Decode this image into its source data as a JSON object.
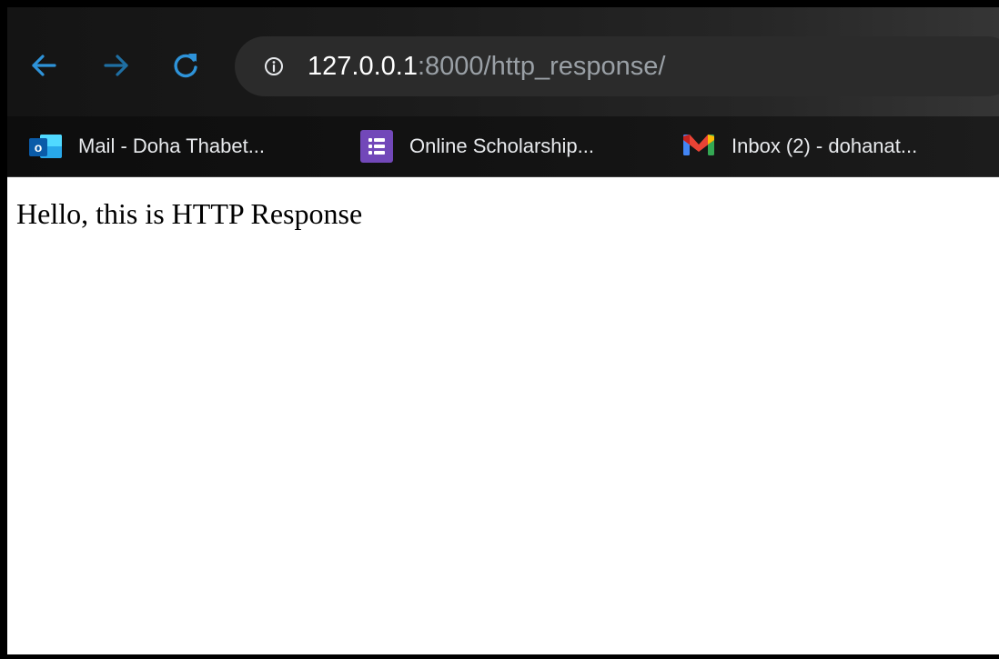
{
  "browser": {
    "address_bar": {
      "host": "127.0.0.1",
      "path": ":8000/http_response/"
    },
    "icons": {
      "back": "arrow-left-icon",
      "forward": "arrow-right-icon",
      "reload": "reload-icon",
      "site_info": "info-icon"
    },
    "colors": {
      "nav_icon": "#2e93d9",
      "toolbar_bg": "#1b1b1b",
      "omnibox_bg": "#2b2b2b"
    }
  },
  "bookmarks": [
    {
      "label": "Mail - Doha Thabet...",
      "icon": "outlook-icon"
    },
    {
      "label": "Online Scholarship...",
      "icon": "google-forms-icon"
    },
    {
      "label": "Inbox (2) - dohanat...",
      "icon": "gmail-icon"
    }
  ],
  "page": {
    "text": "Hello, this is HTTP Response"
  }
}
